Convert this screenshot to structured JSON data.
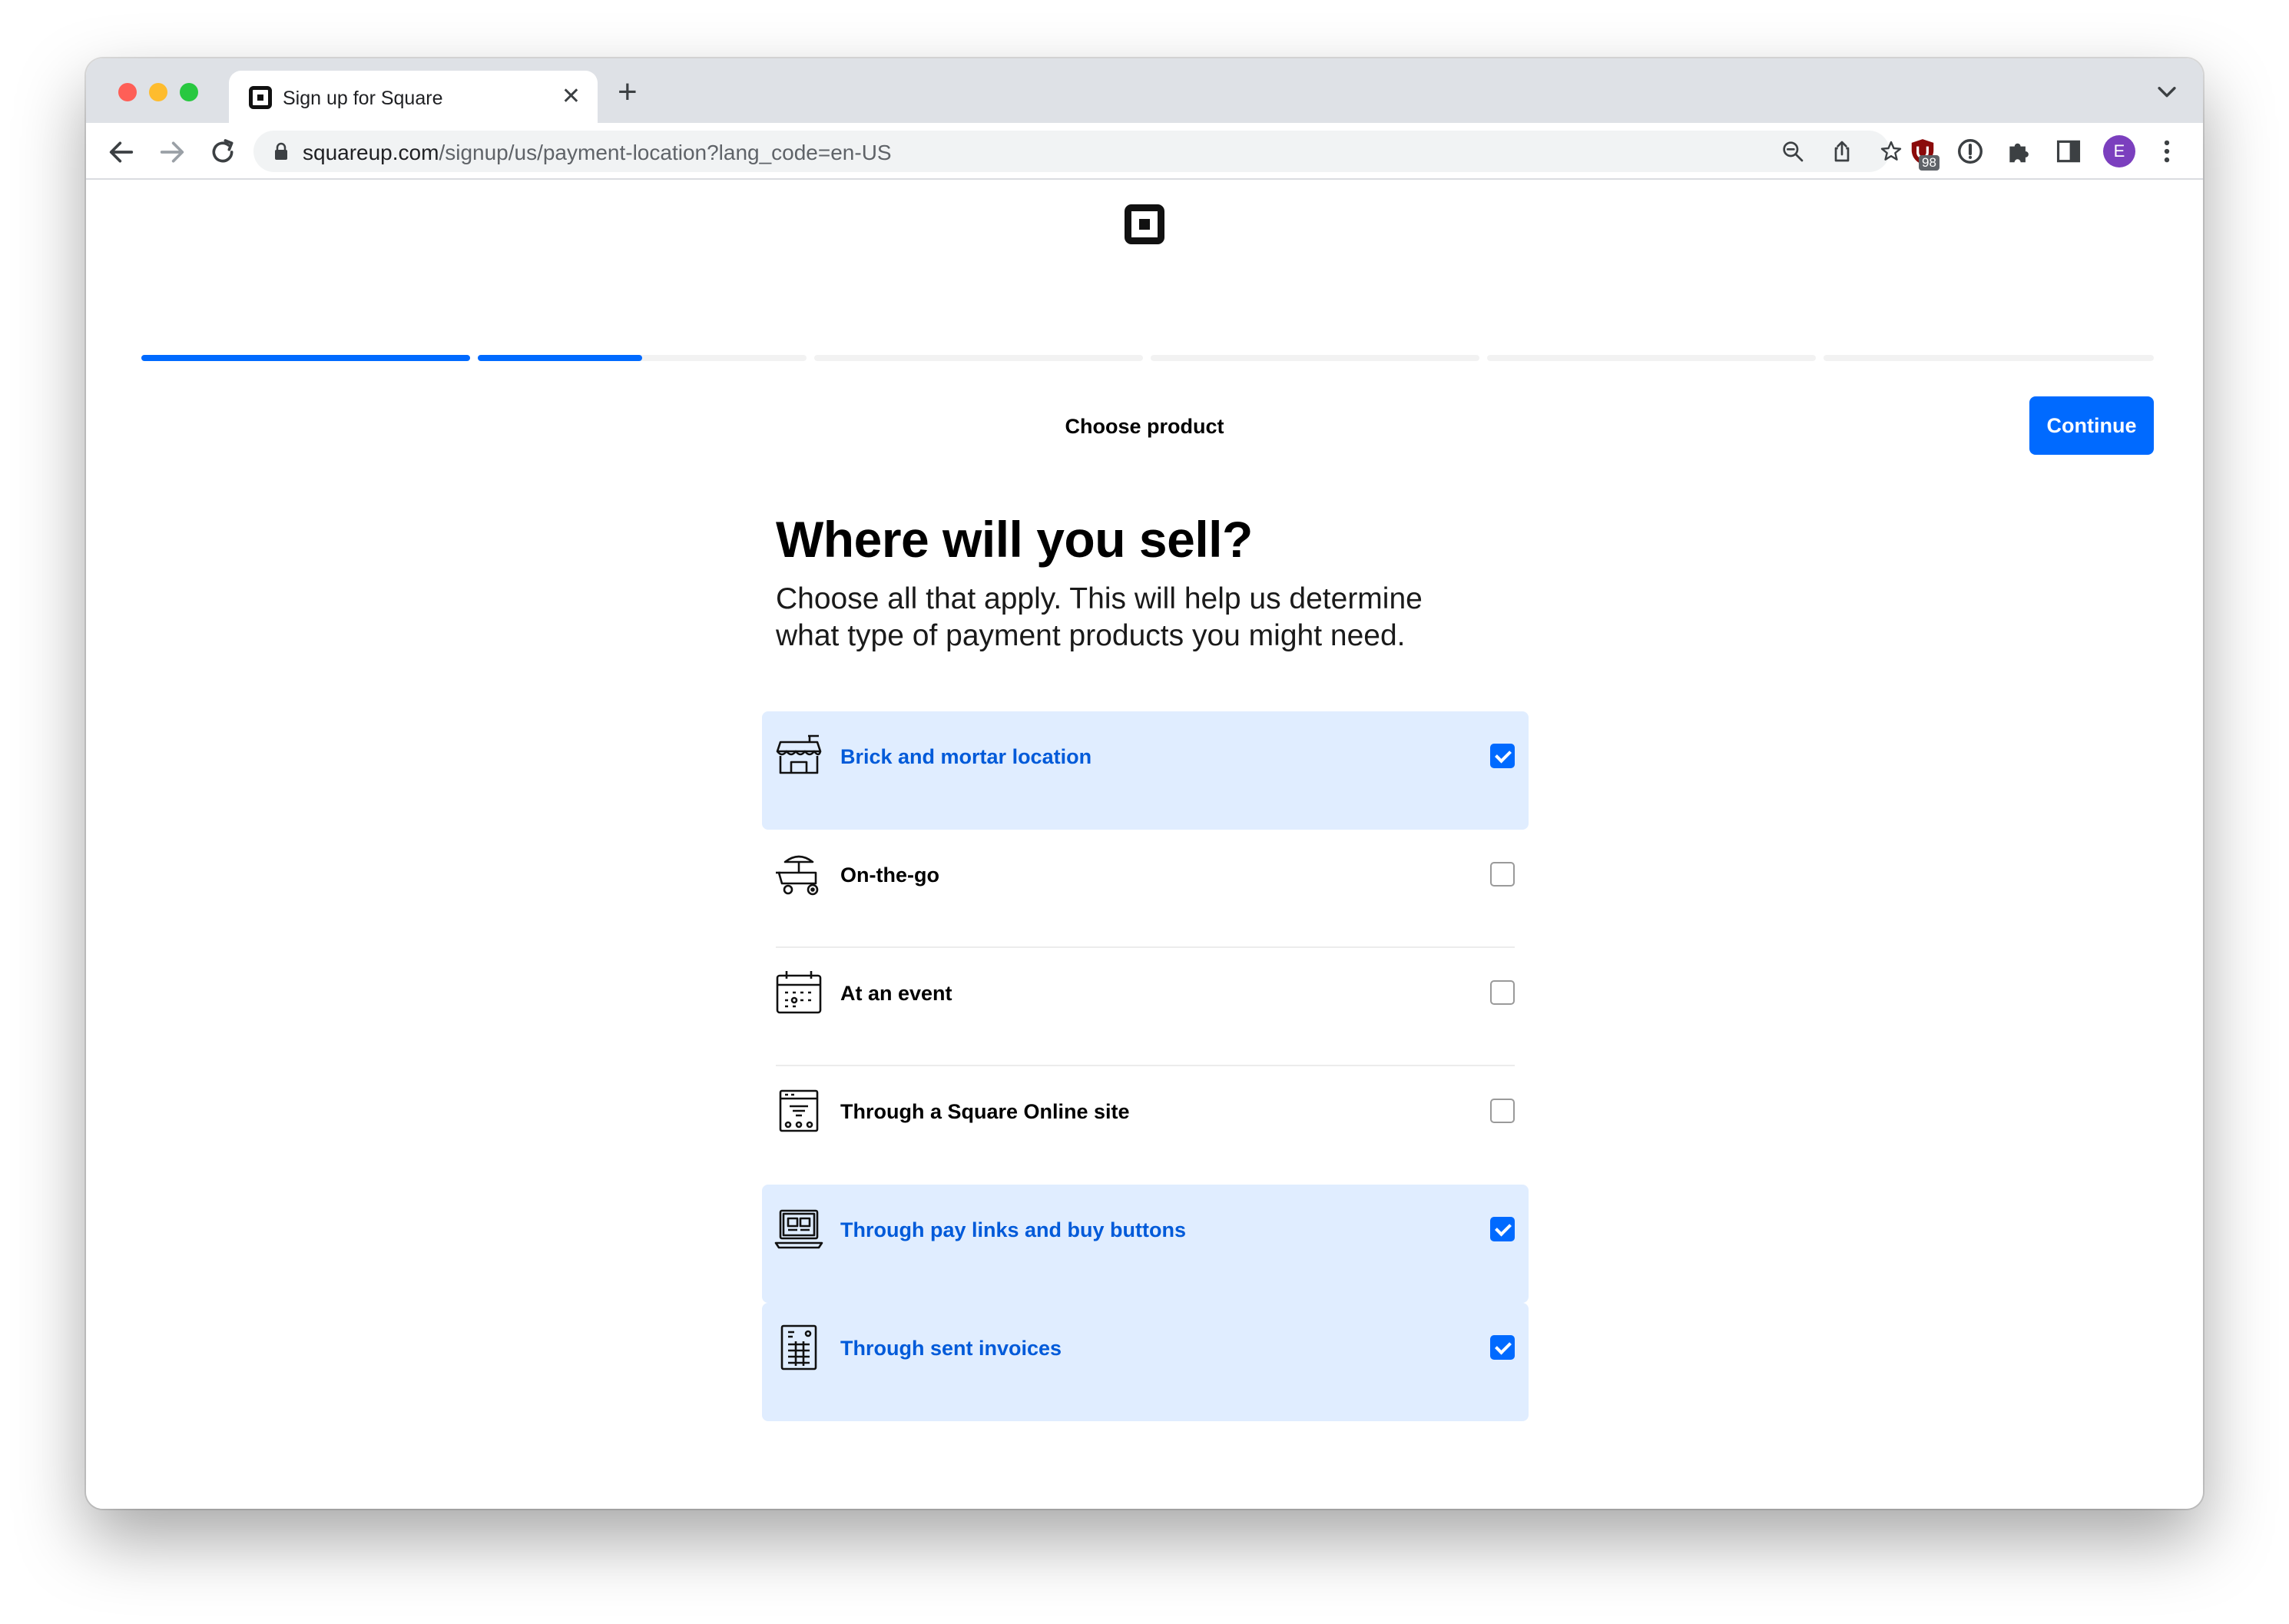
{
  "browser": {
    "tab_title": "Sign up for Square",
    "tab_close": "✕",
    "new_tab": "+",
    "url_host": "squareup.com",
    "url_path": "/signup/us/payment-location?lang_code=en-US",
    "extension_badge": "98",
    "avatar_initial": "E"
  },
  "progress": {
    "steps": [
      {
        "fill": 1.0
      },
      {
        "fill": 0.5
      },
      {
        "fill": 0
      },
      {
        "fill": 0
      },
      {
        "fill": 0
      },
      {
        "fill": 0
      }
    ]
  },
  "header": {
    "step_title": "Choose product",
    "continue_label": "Continue"
  },
  "main": {
    "title": "Where will you sell?",
    "subtitle": "Choose all that apply. This will help us determine what type of payment products you might need.",
    "options": [
      {
        "label": "Brick and mortar location",
        "icon": "storefront-icon",
        "checked": true
      },
      {
        "label": "On-the-go",
        "icon": "food-cart-icon",
        "checked": false
      },
      {
        "label": "At an event",
        "icon": "calendar-icon",
        "checked": false
      },
      {
        "label": "Through a Square Online site",
        "icon": "online-store-icon",
        "checked": false
      },
      {
        "label": "Through pay links and buy buttons",
        "icon": "laptop-icon",
        "checked": true
      },
      {
        "label": "Through sent invoices",
        "icon": "invoice-icon",
        "checked": true
      }
    ]
  },
  "colors": {
    "accent": "#006aff",
    "selected_bg": "#e0edff",
    "selected_text": "#005ad9"
  }
}
